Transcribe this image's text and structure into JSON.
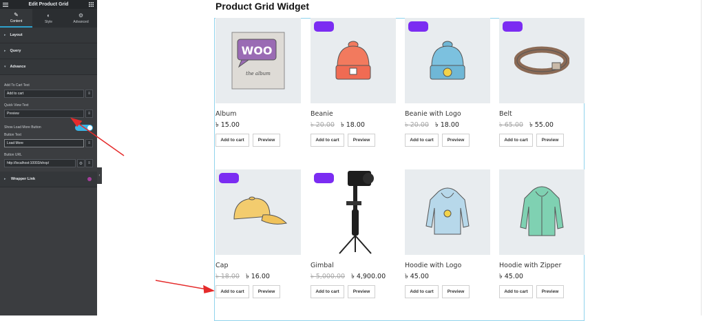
{
  "panel": {
    "title": "Edit Product Grid",
    "tabs": [
      {
        "label": "Content",
        "icon": "pencil-icon"
      },
      {
        "label": "Style",
        "icon": "half-circle-icon"
      },
      {
        "label": "Advanced",
        "icon": "gear-icon"
      }
    ],
    "sections": {
      "layout": "Layout",
      "query": "Query",
      "advance": "Advance",
      "wrapper_link": "Wrapper Link"
    },
    "fields": {
      "add_to_cart_label": "Add To Cart Text",
      "add_to_cart_value": "Add to cart",
      "quick_view_label": "Quick View Text",
      "quick_view_value": "Preview",
      "load_more_label": "Show Load More Button",
      "button_text_label": "Button Text",
      "button_text_value": "Load More",
      "button_url_label": "Button URL",
      "button_url_value": "http://localhost:10003/shop/"
    },
    "accent_color": "#2ea2cc"
  },
  "page": {
    "title": "Product Grid Widget",
    "badge_color": "#7b2cf2",
    "products": [
      {
        "name": "Album",
        "old_price": "",
        "price": "৳ 15.00",
        "badge": false
      },
      {
        "name": "Beanie",
        "old_price": "৳ 20.00",
        "price": "৳ 18.00",
        "badge": true
      },
      {
        "name": "Beanie with Logo",
        "old_price": "৳ 20.00",
        "price": "৳ 18.00",
        "badge": true
      },
      {
        "name": "Belt",
        "old_price": "৳ 65.00",
        "price": "৳ 55.00",
        "badge": true
      },
      {
        "name": "Cap",
        "old_price": "৳ 18.00",
        "price": "৳ 16.00",
        "badge": true
      },
      {
        "name": "Gimbal",
        "old_price": "৳ 5,000.00",
        "price": "৳ 4,900.00",
        "badge": true
      },
      {
        "name": "Hoodie with Logo",
        "old_price": "",
        "price": "৳ 45.00",
        "badge": false
      },
      {
        "name": "Hoodie with Zipper",
        "old_price": "",
        "price": "৳ 45.00",
        "badge": false
      }
    ],
    "add_to_cart": "Add to cart",
    "preview": "Preview",
    "album_logo": "WOO",
    "album_caption": "the album"
  }
}
